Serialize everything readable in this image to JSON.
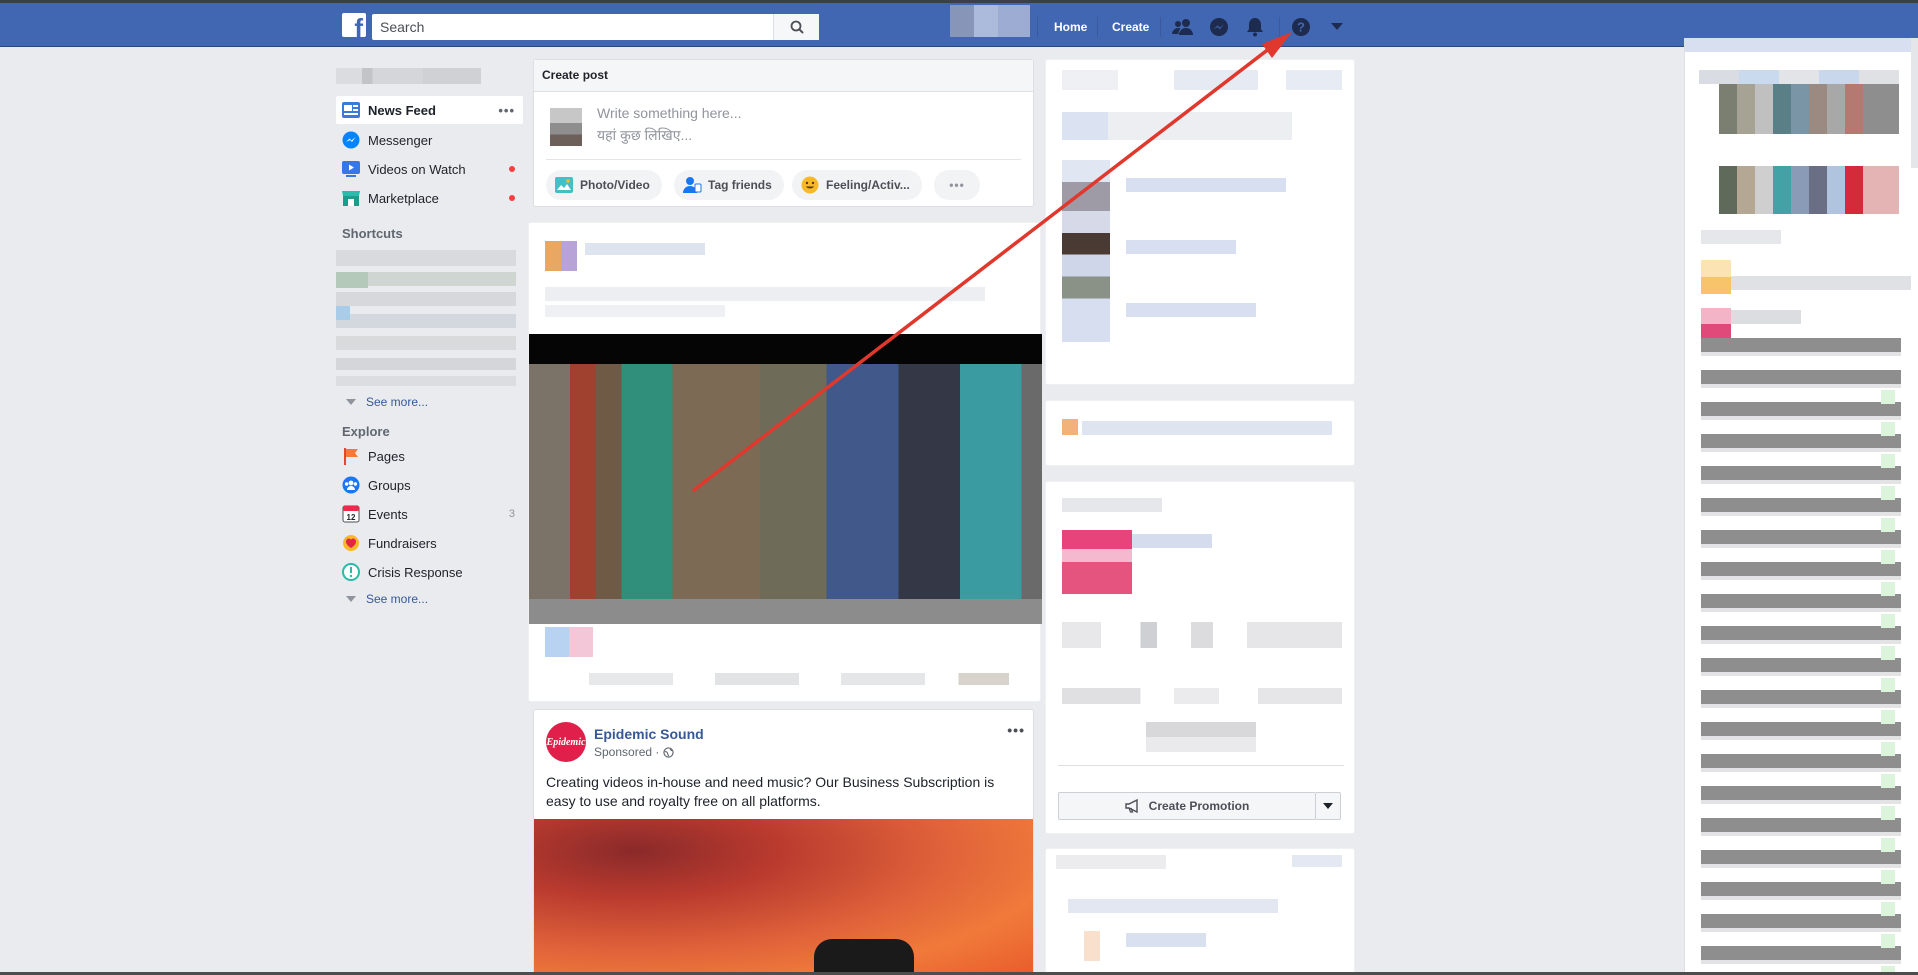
{
  "topbar": {
    "logo": "f",
    "search_placeholder": "Search",
    "home": "Home",
    "create": "Create"
  },
  "left_nav": {
    "items": [
      {
        "label": "News Feed",
        "icon": "news-feed-icon"
      },
      {
        "label": "Messenger",
        "icon": "messenger-icon"
      },
      {
        "label": "Videos on Watch",
        "icon": "watch-icon"
      },
      {
        "label": "Marketplace",
        "icon": "marketplace-icon"
      }
    ],
    "shortcuts_heading": "Shortcuts",
    "see_more_1": "See more...",
    "explore_heading": "Explore",
    "explore": [
      {
        "label": "Pages",
        "icon": "flag-icon"
      },
      {
        "label": "Groups",
        "icon": "groups-icon"
      },
      {
        "label": "Events",
        "icon": "calendar-icon",
        "count": "3",
        "calendar_day": "12"
      },
      {
        "label": "Fundraisers",
        "icon": "fundraiser-icon"
      },
      {
        "label": "Crisis Response",
        "icon": "crisis-response-icon"
      }
    ],
    "see_more_2": "See more..."
  },
  "composer": {
    "title": "Create post",
    "placeholder_en": "Write something here...",
    "placeholder_hi": "यहां कुछ लिखिए...",
    "buttons": [
      {
        "label": "Photo/Video",
        "icon": "photo-icon"
      },
      {
        "label": "Tag friends",
        "icon": "tag-friends-icon"
      },
      {
        "label": "Feeling/Activ...",
        "icon": "feeling-icon"
      }
    ]
  },
  "ad_post": {
    "page_name": "Epidemic Sound",
    "logo_text": "Epidemic",
    "sponsored": "Sponsored ·",
    "text": "Creating videos in-house and need music? Our Business Subscription is easy to use and royalty free on all platforms."
  },
  "right_rail": {
    "create_promotion": "Create Promotion"
  },
  "colors": {
    "brand_blue": "#4267b2",
    "link_blue": "#365899",
    "notification_red": "#fa3e3e",
    "annotation_arrow": "#e0382d"
  }
}
